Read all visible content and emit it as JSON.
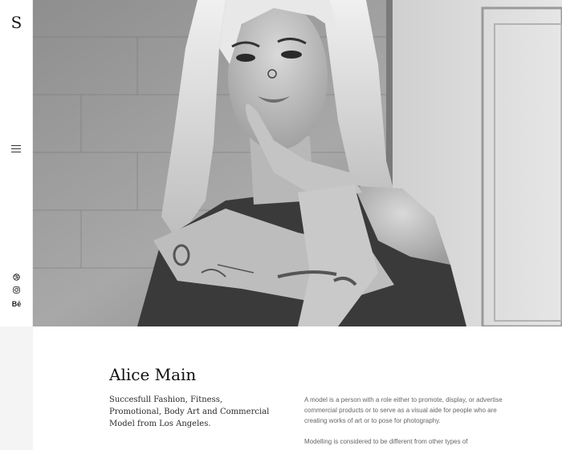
{
  "brand": {
    "logo_text": "S"
  },
  "sidebar": {
    "menu_icon": "hamburger-icon",
    "social": [
      {
        "icon": "dribbble-icon"
      },
      {
        "icon": "instagram-icon"
      },
      {
        "icon": "behance-icon",
        "label": "Bē"
      }
    ]
  },
  "hero": {
    "image": "black-and-white portrait photo"
  },
  "profile": {
    "name": "Alice Main",
    "intro": "Succesfull Fashion, Fitness, Promotional, Body Art and Commercial Model from Los Angeles.",
    "description_1": "A model is a person with a role either to promote, display, or advertise commercial products or to serve as a visual aide for people who are creating works of art or to pose for photography.",
    "description_2": "Modelling is considered to be different from other types of"
  },
  "colors": {
    "sidebar_bg": "#ffffff",
    "sidebar_lower_bg": "#f4f4f4",
    "text": "#111111",
    "muted_text": "#666666"
  }
}
